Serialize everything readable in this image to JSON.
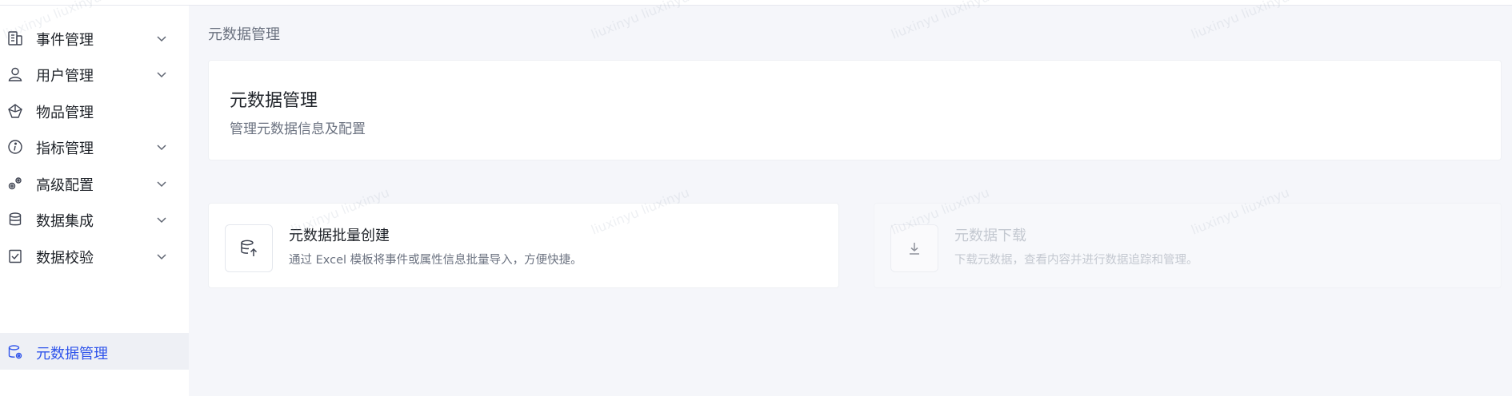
{
  "sidebar": {
    "items": [
      {
        "label": "事件管理",
        "icon": "document-icon",
        "has_children": true
      },
      {
        "label": "用户管理",
        "icon": "user-icon",
        "has_children": true
      },
      {
        "label": "物品管理",
        "icon": "cube-icon",
        "has_children": false
      },
      {
        "label": "指标管理",
        "icon": "info-circle-icon",
        "has_children": true
      },
      {
        "label": "高级配置",
        "icon": "gears-icon",
        "has_children": true
      },
      {
        "label": "数据集成",
        "icon": "database-icon",
        "has_children": true
      },
      {
        "label": "数据校验",
        "icon": "checklist-icon",
        "has_children": true
      },
      {
        "label": "元数据管理",
        "icon": "database-settings-icon",
        "has_children": false,
        "active": true
      }
    ]
  },
  "breadcrumb": "元数据管理",
  "header": {
    "title": "元数据管理",
    "subtitle": "管理元数据信息及配置"
  },
  "cards": {
    "create": {
      "title": "元数据批量创建",
      "description": "通过 Excel 模板将事件或属性信息批量导入，方便快捷。",
      "icon": "database-upload-icon"
    },
    "download": {
      "title": "元数据下载",
      "description": "下载元数据，查看内容并进行数据追踪和管理。",
      "icon": "download-icon"
    }
  },
  "watermark": "liuxinyu liuxinyu",
  "colors": {
    "accent": "#2f54eb",
    "background": "#f5f6fa",
    "active_bg": "#eef0f5"
  }
}
